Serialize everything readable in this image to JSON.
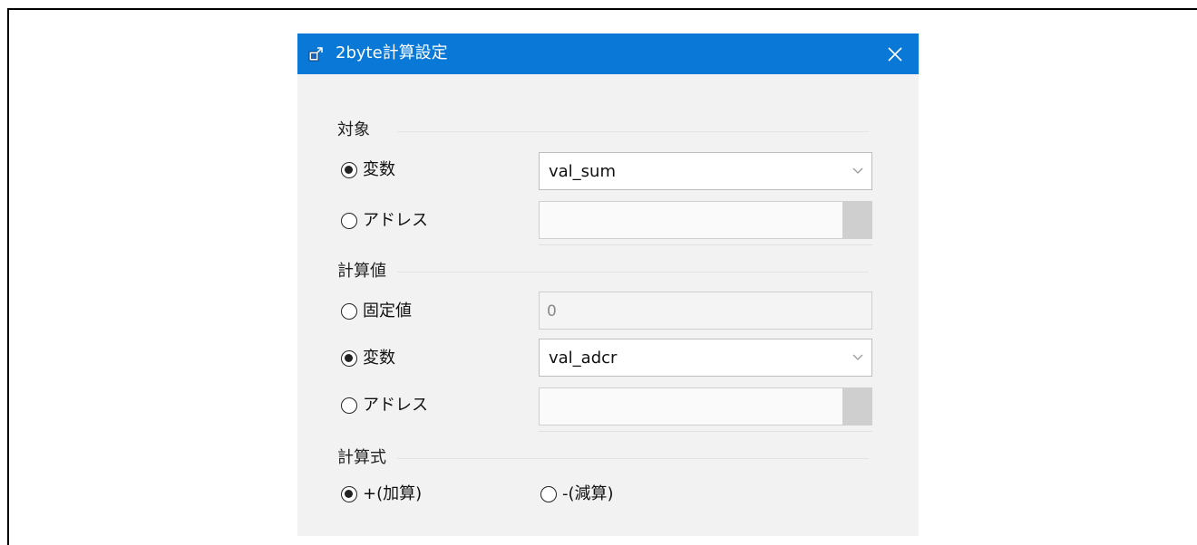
{
  "dialog": {
    "title": "2byte計算設定",
    "target_group": {
      "label": "対象",
      "options": [
        {
          "label": "変数",
          "checked": true
        },
        {
          "label": "アドレス",
          "checked": false
        }
      ],
      "variable_value": "val_sum",
      "address_value": ""
    },
    "value_group": {
      "label": "計算値",
      "options": [
        {
          "label": "固定値",
          "checked": false
        },
        {
          "label": "変数",
          "checked": true
        },
        {
          "label": "アドレス",
          "checked": false
        }
      ],
      "fixed_value": "0",
      "variable_value": "val_adcr",
      "address_value": ""
    },
    "formula_group": {
      "label": "計算式",
      "options": [
        {
          "label": "+(加算)",
          "checked": true
        },
        {
          "label": "-(減算)",
          "checked": false
        }
      ]
    }
  },
  "colors": {
    "titlebar": "#0a78d7",
    "background": "#f2f2f2"
  }
}
